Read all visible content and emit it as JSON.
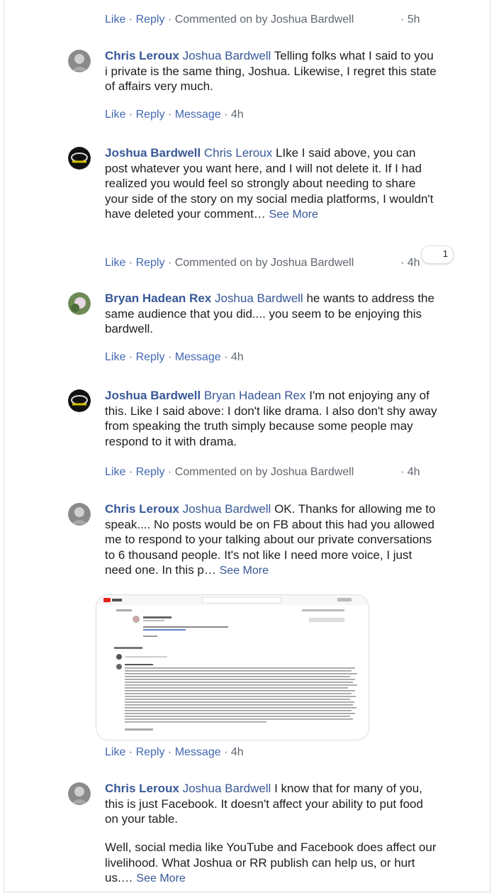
{
  "comments": [
    {
      "author": "",
      "mention": "",
      "text": "",
      "actions": {
        "like": "Like",
        "reply": "Reply",
        "meta": "Commented on by Joshua Bardwell",
        "time": "5h"
      }
    },
    {
      "author": "Chris Leroux",
      "mention": "Joshua Bardwell",
      "text": "Telling folks what I said to you i private is the same thing, Joshua. Likewise, I regret this state of affairs very much.",
      "actions": {
        "like": "Like",
        "reply": "Reply",
        "message": "Message",
        "time": "4h"
      }
    },
    {
      "author": "Joshua Bardwell",
      "mention": "Chris Leroux",
      "text": "LIke I said above, you can post whatever you want here, and I will not delete it. If I had realized you would feel so strongly about needing to share your side of the story on my social media platforms, I wouldn't have deleted your comment…",
      "see_more": "See More",
      "reactions": "1",
      "actions": {
        "like": "Like",
        "reply": "Reply",
        "meta": "Commented on by Joshua Bardwell",
        "time": "4h"
      }
    },
    {
      "author": "Bryan Hadean Rex",
      "mention": "Joshua Bardwell",
      "text": "he wants to address the same audience that you did.... you seem to be enjoying this bardwell.",
      "actions": {
        "like": "Like",
        "reply": "Reply",
        "message": "Message",
        "time": "4h"
      }
    },
    {
      "author": "Joshua Bardwell",
      "mention": "Bryan Hadean Rex",
      "text": "I'm not enjoying any of this. Like I said above: I don't like drama. I also don't shy away from speaking the truth simply because some people may respond to it with drama.",
      "actions": {
        "like": "Like",
        "reply": "Reply",
        "meta": "Commented on by Joshua Bardwell",
        "time": "4h"
      }
    },
    {
      "author": "Chris Leroux",
      "mention": "Joshua Bardwell",
      "text": "OK. Thanks for allowing me to speak.... No posts would be on FB about this had you allowed me to respond to your talking about our private conversations to 6 thousand people. It's not like I need more voice, I just need one. In this p…",
      "see_more": "See More",
      "actions": {
        "like": "Like",
        "reply": "Reply",
        "message": "Message",
        "time": "4h"
      }
    },
    {
      "author": "Chris Leroux",
      "mention": "Joshua Bardwell",
      "text": "I know that for many of you, this is just Facebook. It doesn't affect your ability to put food on your table.",
      "text2": "Well, social media like YouTube and Facebook does affect our livelihood. What Joshua or RR publish can help us, or hurt us.…",
      "see_more": "See More"
    }
  ],
  "colors": {
    "link": "#385898",
    "action_link": "#4267b2",
    "meta": "#616770",
    "text": "#1c1e21",
    "border": "#dddfe2"
  }
}
